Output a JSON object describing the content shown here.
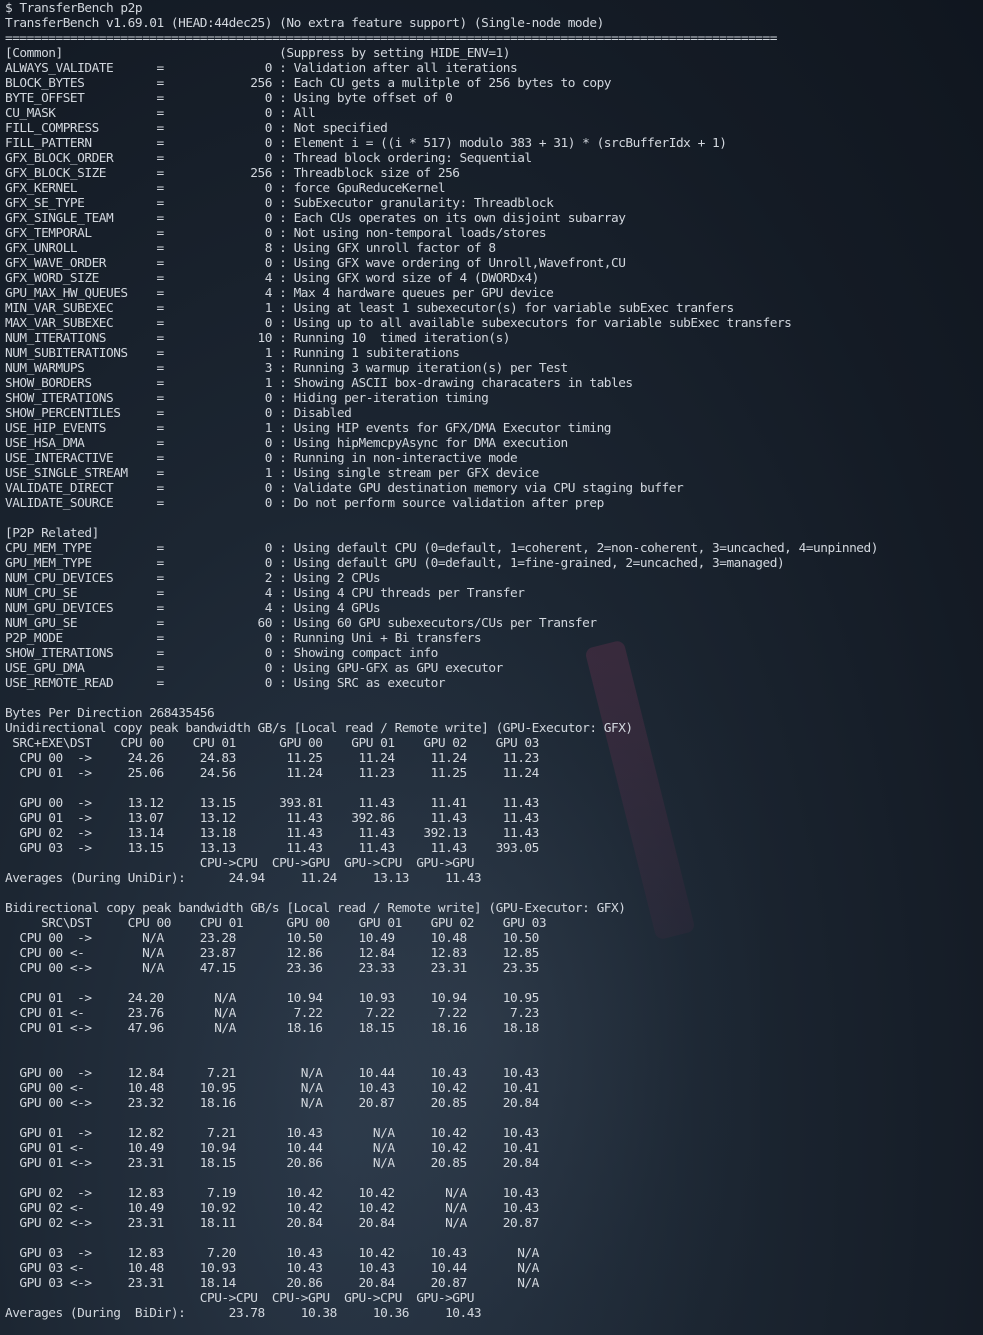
{
  "terminal": {
    "lines": [
      "$ TransferBench p2p",
      "TransferBench v1.69.01 (HEAD:44dec25) (No extra feature support) (Single-node mode)",
      "===========================================================================================================",
      "[Common]                              (Suppress by setting HIDE_ENV=1)",
      "ALWAYS_VALIDATE      =              0 : Validation after all iterations",
      "BLOCK_BYTES          =            256 : Each CU gets a mulitple of 256 bytes to copy",
      "BYTE_OFFSET          =              0 : Using byte offset of 0",
      "CU_MASK              =              0 : All",
      "FILL_COMPRESS        =              0 : Not specified",
      "FILL_PATTERN         =              0 : Element i = ((i * 517) modulo 383 + 31) * (srcBufferIdx + 1)",
      "GFX_BLOCK_ORDER      =              0 : Thread block ordering: Sequential",
      "GFX_BLOCK_SIZE       =            256 : Threadblock size of 256",
      "GFX_KERNEL           =              0 : force GpuReduceKernel",
      "GFX_SE_TYPE          =              0 : SubExecutor granularity: Threadblock",
      "GFX_SINGLE_TEAM      =              0 : Each CUs operates on its own disjoint subarray",
      "GFX_TEMPORAL         =              0 : Not using non-temporal loads/stores",
      "GFX_UNROLL           =              8 : Using GFX unroll factor of 8",
      "GFX_WAVE_ORDER       =              0 : Using GFX wave ordering of Unroll,Wavefront,CU",
      "GFX_WORD_SIZE        =              4 : Using GFX word size of 4 (DWORDx4)",
      "GPU_MAX_HW_QUEUES    =              4 : Max 4 hardware queues per GPU device",
      "MIN_VAR_SUBEXEC      =              1 : Using at least 1 subexecutor(s) for variable subExec tranfers",
      "MAX_VAR_SUBEXEC      =              0 : Using up to all available subexecutors for variable subExec transfers",
      "NUM_ITERATIONS       =             10 : Running 10  timed iteration(s)",
      "NUM_SUBITERATIONS    =              1 : Running 1 subiterations",
      "NUM_WARMUPS          =              3 : Running 3 warmup iteration(s) per Test",
      "SHOW_BORDERS         =              1 : Showing ASCII box-drawing characaters in tables",
      "SHOW_ITERATIONS      =              0 : Hiding per-iteration timing",
      "SHOW_PERCENTILES     =              0 : Disabled",
      "USE_HIP_EVENTS       =              1 : Using HIP events for GFX/DMA Executor timing",
      "USE_HSA_DMA          =              0 : Using hipMemcpyAsync for DMA execution",
      "USE_INTERACTIVE      =              0 : Running in non-interactive mode",
      "USE_SINGLE_STREAM    =              1 : Using single stream per GFX device",
      "VALIDATE_DIRECT      =              0 : Validate GPU destination memory via CPU staging buffer",
      "VALIDATE_SOURCE      =              0 : Do not perform source validation after prep",
      "",
      "[P2P Related]",
      "CPU_MEM_TYPE         =              0 : Using default CPU (0=default, 1=coherent, 2=non-coherent, 3=uncached, 4=unpinned)",
      "GPU_MEM_TYPE         =              0 : Using default GPU (0=default, 1=fine-grained, 2=uncached, 3=managed)",
      "NUM_CPU_DEVICES      =              2 : Using 2 CPUs",
      "NUM_CPU_SE           =              4 : Using 4 CPU threads per Transfer",
      "NUM_GPU_DEVICES      =              4 : Using 4 GPUs",
      "NUM_GPU_SE           =             60 : Using 60 GPU subexecutors/CUs per Transfer",
      "P2P_MODE             =              0 : Running Uni + Bi transfers",
      "SHOW_ITERATIONS      =              0 : Showing compact info",
      "USE_GPU_DMA          =              0 : Using GPU-GFX as GPU executor",
      "USE_REMOTE_READ      =              0 : Using SRC as executor",
      "",
      "Bytes Per Direction 268435456",
      "Unidirectional copy peak bandwidth GB/s [Local read / Remote write] (GPU-Executor: GFX)",
      " SRC+EXE\\DST    CPU 00    CPU 01      GPU 00    GPU 01    GPU 02    GPU 03",
      "  CPU 00  ->     24.26     24.83       11.25     11.24     11.24     11.23",
      "  CPU 01  ->     25.06     24.56       11.24     11.23     11.25     11.24",
      "",
      "  GPU 00  ->     13.12     13.15      393.81     11.43     11.41     11.43",
      "  GPU 01  ->     13.07     13.12       11.43    392.86     11.43     11.43",
      "  GPU 02  ->     13.14     13.18       11.43     11.43    392.13     11.43",
      "  GPU 03  ->     13.15     13.13       11.43     11.43     11.43    393.05",
      "                           CPU->CPU  CPU->GPU  GPU->CPU  GPU->GPU",
      "Averages (During UniDir):      24.94     11.24     13.13     11.43",
      "",
      "Bidirectional copy peak bandwidth GB/s [Local read / Remote write] (GPU-Executor: GFX)",
      "     SRC\\DST     CPU 00    CPU 01      GPU 00    GPU 01    GPU 02    GPU 03",
      "  CPU 00  ->       N/A     23.28       10.50     10.49     10.48     10.50",
      "  CPU 00 <-        N/A     23.87       12.86     12.84     12.83     12.85",
      "  CPU 00 <->       N/A     47.15       23.36     23.33     23.31     23.35",
      "",
      "  CPU 01  ->     24.20       N/A       10.94     10.93     10.94     10.95",
      "  CPU 01 <-      23.76       N/A        7.22      7.22      7.22      7.23",
      "  CPU 01 <->     47.96       N/A       18.16     18.15     18.16     18.18",
      "",
      "",
      "  GPU 00  ->     12.84      7.21         N/A     10.44     10.43     10.43",
      "  GPU 00 <-      10.48     10.95         N/A     10.43     10.42     10.41",
      "  GPU 00 <->     23.32     18.16         N/A     20.87     20.85     20.84",
      "",
      "  GPU 01  ->     12.82      7.21       10.43       N/A     10.42     10.43",
      "  GPU 01 <-      10.49     10.94       10.44       N/A     10.42     10.41",
      "  GPU 01 <->     23.31     18.15       20.86       N/A     20.85     20.84",
      "",
      "  GPU 02  ->     12.83      7.19       10.42     10.42       N/A     10.43",
      "  GPU 02 <-      10.49     10.92       10.42     10.42       N/A     10.43",
      "  GPU 02 <->     23.31     18.11       20.84     20.84       N/A     20.87",
      "",
      "  GPU 03  ->     12.83      7.20       10.43     10.42     10.43       N/A",
      "  GPU 03 <-      10.48     10.93       10.43     10.43     10.44       N/A",
      "  GPU 03 <->     23.31     18.14       20.86     20.84     20.87       N/A",
      "                           CPU->CPU  CPU->GPU  GPU->CPU  GPU->GPU",
      "Averages (During  BiDir):      23.78     10.38     10.36     10.43"
    ]
  }
}
